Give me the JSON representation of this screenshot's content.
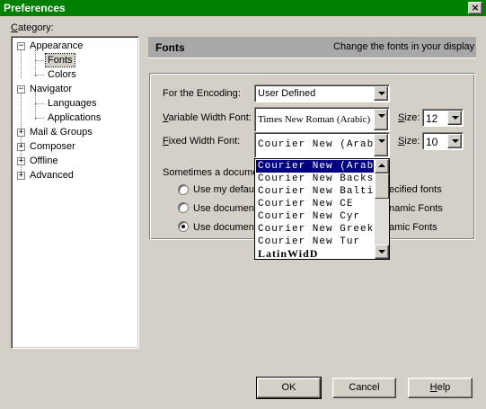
{
  "window": {
    "title": "Preferences",
    "close_glyph": "×"
  },
  "category": {
    "label_u": "C",
    "label_rest": "ategory:",
    "tree": [
      {
        "label": "Appearance",
        "expander": "−"
      },
      {
        "label": "Fonts"
      },
      {
        "label": "Colors"
      },
      {
        "label": "Navigator",
        "expander": "−"
      },
      {
        "label": "Languages"
      },
      {
        "label": "Applications"
      },
      {
        "label": "Mail & Groups",
        "expander": "+"
      },
      {
        "label": "Composer",
        "expander": "+"
      },
      {
        "label": "Offline",
        "expander": "+"
      },
      {
        "label": "Advanced",
        "expander": "+"
      }
    ],
    "selected": "Fonts"
  },
  "panel": {
    "title": "Fonts",
    "subtitle": "Change the fonts in your display"
  },
  "encoding": {
    "label": "For the Encoding:",
    "value": "User Defined"
  },
  "variable_font": {
    "label_u": "V",
    "label_rest": "ariable Width Font:",
    "value": "Times New Roman (Arabic)",
    "size_label_u": "S",
    "size_label_rest": "ize:",
    "size": "12"
  },
  "fixed_font": {
    "label_u": "F",
    "label_rest": "ixed Width Font:",
    "value": "Courier New (Arabic)",
    "size_label_u": "S",
    "size_label_rest": "ize:",
    "size": "10"
  },
  "dynamic": {
    "intro": "Sometimes a docume",
    "options": [
      {
        "left": "Use my defaul",
        "right": "ecified fonts",
        "checked": false
      },
      {
        "left": "Use document",
        "right": "namic Fonts",
        "checked": false
      },
      {
        "left": "Use document",
        "right": "amic Fonts",
        "checked": true
      }
    ]
  },
  "dropdown_items": [
    "Courier New (Arabic)",
    "Courier New Backslash",
    "Courier New Baltic",
    "Courier New CE",
    "Courier New Cyr",
    "Courier New Greek",
    "Courier New Tur",
    "LatinWidD"
  ],
  "buttons": {
    "ok": "OK",
    "cancel": "Cancel",
    "help_u": "H",
    "help_rest": "elp"
  },
  "colors": {
    "titlebar": "#008000",
    "face": "#d4d0c8",
    "highlight": "#000080",
    "header": "#a8a8a8"
  }
}
